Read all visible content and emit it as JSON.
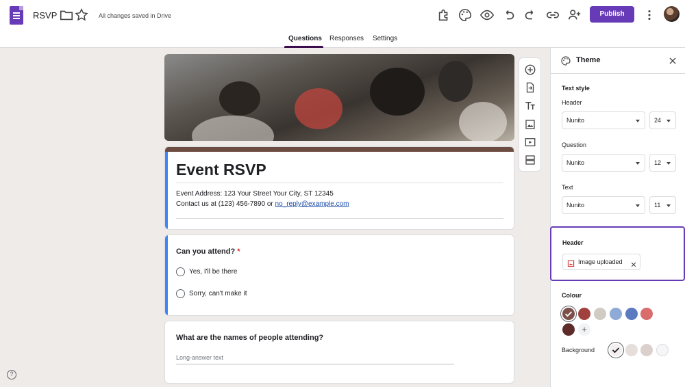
{
  "app": {
    "doc_title": "RSVP",
    "save_status": "All changes saved in Drive",
    "publish_label": "Publish"
  },
  "tabs": [
    {
      "label": "Questions",
      "active": true
    },
    {
      "label": "Responses",
      "active": false
    },
    {
      "label": "Settings",
      "active": false
    }
  ],
  "form": {
    "title": "Event RSVP",
    "description_line1": "Event Address: 123 Your Street Your City, ST 12345",
    "description_line2_prefix": "Contact us at (123) 456-7890 or ",
    "description_email": "no_reply@example.com",
    "questions": [
      {
        "title": "Can you attend?",
        "required_mark": "*",
        "options": [
          "Yes,  I'll be there",
          "Sorry, can't make it"
        ]
      },
      {
        "title": "What are the names of people attending?",
        "placeholder": "Long-answer text"
      }
    ]
  },
  "theme_panel": {
    "title": "Theme",
    "text_style_label": "Text style",
    "header_label": "Header",
    "header_font": "Nunito",
    "header_size": "24",
    "question_label": "Question",
    "question_font": "Nunito",
    "question_size": "12",
    "text_label": "Text",
    "text_font": "Nunito",
    "text_size": "11",
    "header_image_section": "Header",
    "header_image_chip": "Image uploaded",
    "colour_label": "Colour",
    "colour_swatches": [
      "#7b4f4a",
      "#a0413d",
      "#d0ccc3",
      "#8eaad6",
      "#5b7ac0",
      "#d96c6c",
      "#5e2b2b"
    ],
    "background_label": "Background",
    "background_swatches": [
      "#f3efee",
      "#e6dedb",
      "#dbd0cc",
      "#f6f6f6"
    ]
  },
  "colors": {
    "accent": "#673ab7",
    "theme_color": "#6d4c41",
    "focus_bar": "#4285f4"
  }
}
